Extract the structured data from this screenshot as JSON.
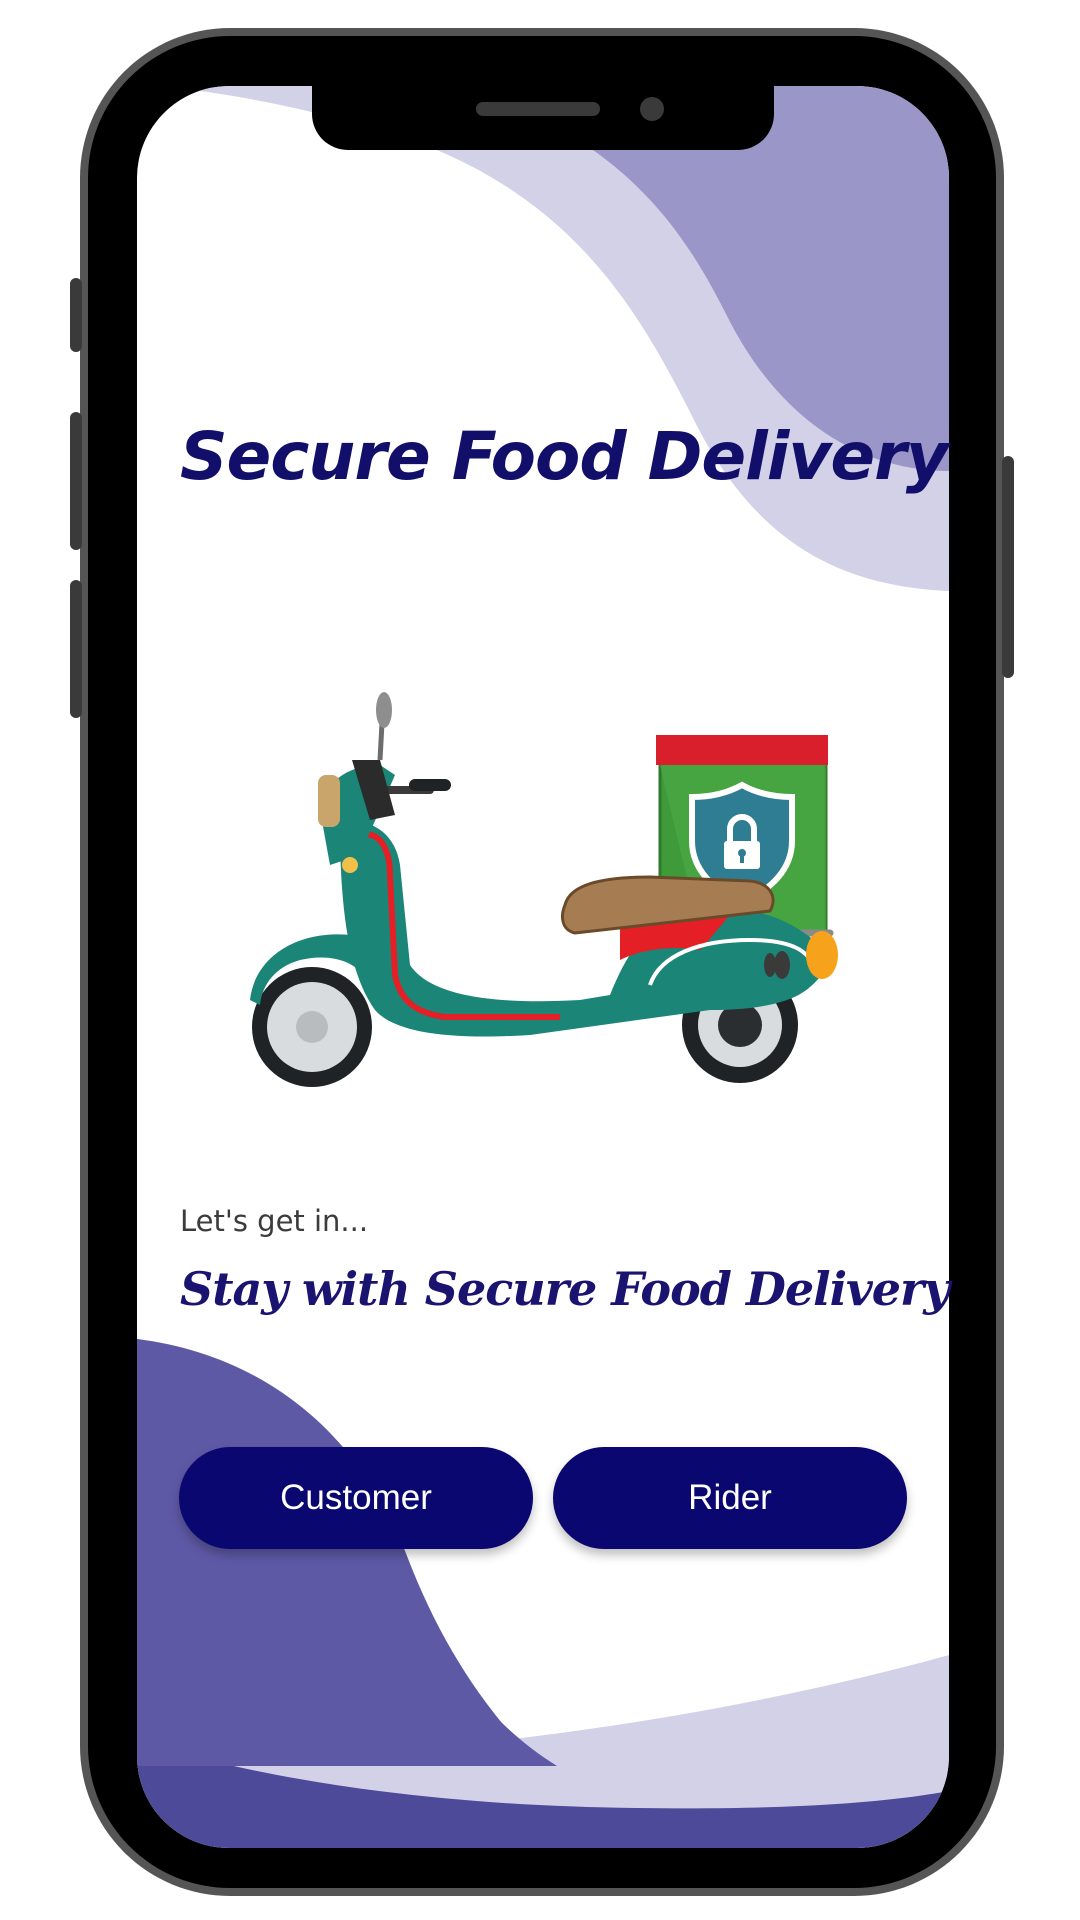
{
  "app": {
    "title": "Secure Food Delivery"
  },
  "hero": {
    "illustration": "scooter-with-secure-delivery-box",
    "icon": "shield-lock-icon"
  },
  "welcome": {
    "intro": "Let's get in...",
    "tagline": "Stay with Secure Food Delivery"
  },
  "actions": {
    "customer_label": "Customer",
    "rider_label": "Rider"
  },
  "colors": {
    "primary": "#0a0870",
    "title": "#120f6b",
    "wave_light": "#d3d1e8",
    "wave_mid": "#9a97c8",
    "wave_dark": "#5e59a5",
    "wave_deep": "#4e4a9a",
    "scooter_body": "#1b8577",
    "delivery_box": "#3f9a3a",
    "box_lid": "#d81f2b"
  }
}
